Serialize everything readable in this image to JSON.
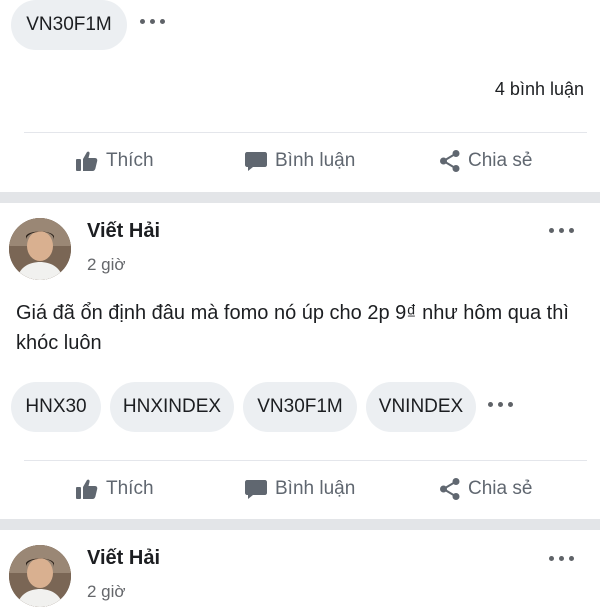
{
  "posts": [
    {
      "tags": [
        "VN30F1M"
      ],
      "comments_label": "4 bình luận",
      "actions": {
        "like": "Thích",
        "comment": "Bình luận",
        "share": "Chia sẻ"
      }
    },
    {
      "author": "Viết Hải",
      "time": "2 giờ",
      "text": "Giá đã ổn định đâu mà fomo nó úp cho 2p 9₫ như hôm qua thì khóc luôn",
      "tags": [
        "HNX30",
        "HNXINDEX",
        "VN30F1M",
        "VNINDEX"
      ],
      "actions": {
        "like": "Thích",
        "comment": "Bình luận",
        "share": "Chia sẻ"
      }
    },
    {
      "author": "Viết Hải",
      "time": "2 giờ"
    }
  ],
  "icons": {
    "like": "thumbs-up-icon",
    "comment": "speech-bubble-icon",
    "share": "share-icon",
    "more": "more-dots-icon"
  },
  "colors": {
    "chip_bg": "#eceff2",
    "action_text": "#606770",
    "separator": "#e3e5e8"
  }
}
